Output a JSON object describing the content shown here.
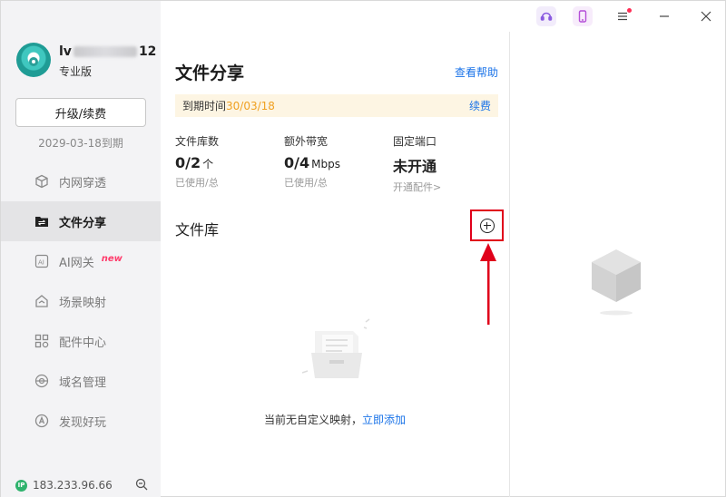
{
  "user": {
    "name_prefix": "lv",
    "name_suffix": "12",
    "plan": "专业版",
    "upgrade_label": "升级/续费",
    "expire_text": "2029-03-18到期"
  },
  "nav": {
    "items": [
      {
        "label": "内网穿透",
        "icon": "cube-icon"
      },
      {
        "label": "文件分享",
        "icon": "share-folder-icon",
        "active": true
      },
      {
        "label": "AI网关",
        "icon": "ai-icon",
        "badge": "new"
      },
      {
        "label": "场景映射",
        "icon": "house-icon"
      },
      {
        "label": "配件中心",
        "icon": "grid-icon"
      },
      {
        "label": "域名管理",
        "icon": "globe-icon"
      },
      {
        "label": "发现好玩",
        "icon": "compass-icon"
      }
    ]
  },
  "footer": {
    "ip_badge": "IP",
    "ip": "183.233.96.66"
  },
  "main": {
    "title": "文件分享",
    "help_link": "查看帮助",
    "expire_bar": {
      "prefix": "到期时间",
      "date": "30/03/18",
      "renew": "续费"
    },
    "stats": [
      {
        "label": "文件库数",
        "value": "0/2",
        "unit": "个",
        "sub": "已使用/总"
      },
      {
        "label": "额外带宽",
        "value": "0/4",
        "unit": "Mbps",
        "sub": "已使用/总"
      },
      {
        "label": "固定端口",
        "value": "未开通",
        "unit": "",
        "sub": "开通配件>"
      }
    ],
    "library_title": "文件库",
    "empty_text": "当前无自定义映射，",
    "empty_link": "立即添加"
  },
  "colors": {
    "accent": "#1a73e8",
    "highlight": "#e0001a",
    "warning_bg": "#fdf5e3",
    "warning_text": "#f0a020",
    "sidebar_bg": "#f3f3f5",
    "new_badge": "#ff3b6b"
  }
}
